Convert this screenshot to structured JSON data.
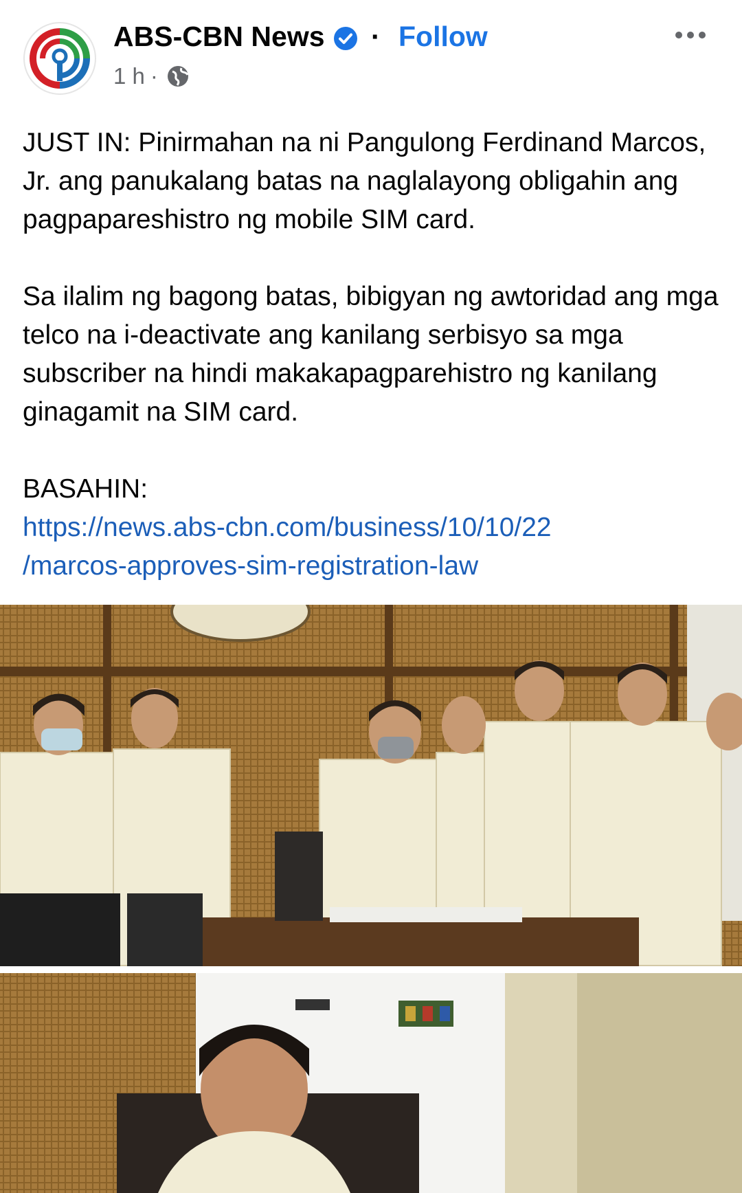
{
  "post": {
    "page_name": "ABS-CBN News",
    "separator": "·",
    "follow_label": "Follow",
    "time": "1 h",
    "meta_sep": "·",
    "verified_icon": "verified-badge-icon",
    "privacy_icon": "globe-icon",
    "more_icon": "more-options-icon",
    "paragraphs": [
      "JUST IN: Pinirmahan na ni Pangulong Ferdinand Marcos, Jr. ang panukalang batas na naglalayong obligahin ang pagpapareshistro ng mobile SIM card.",
      "Sa ilalim ng bagong batas, bibigyan ng awtoridad ang mga telco na i-deactivate ang kanilang serbisyo sa mga subscriber na hindi makakapagparehistro ng kanilang ginagamit na SIM card.",
      "BASAHIN:"
    ],
    "link_line1": "https://news.abs-cbn.com/business/10/10/22",
    "link_line2": "/marcos-approves-sim-registration-law"
  },
  "colors": {
    "accent": "#1b74e4",
    "link": "#1b5eb8",
    "meta_text": "#65676b",
    "logo_red": "#d32027",
    "logo_green": "#2e9e46",
    "logo_blue": "#1c6fb8"
  }
}
